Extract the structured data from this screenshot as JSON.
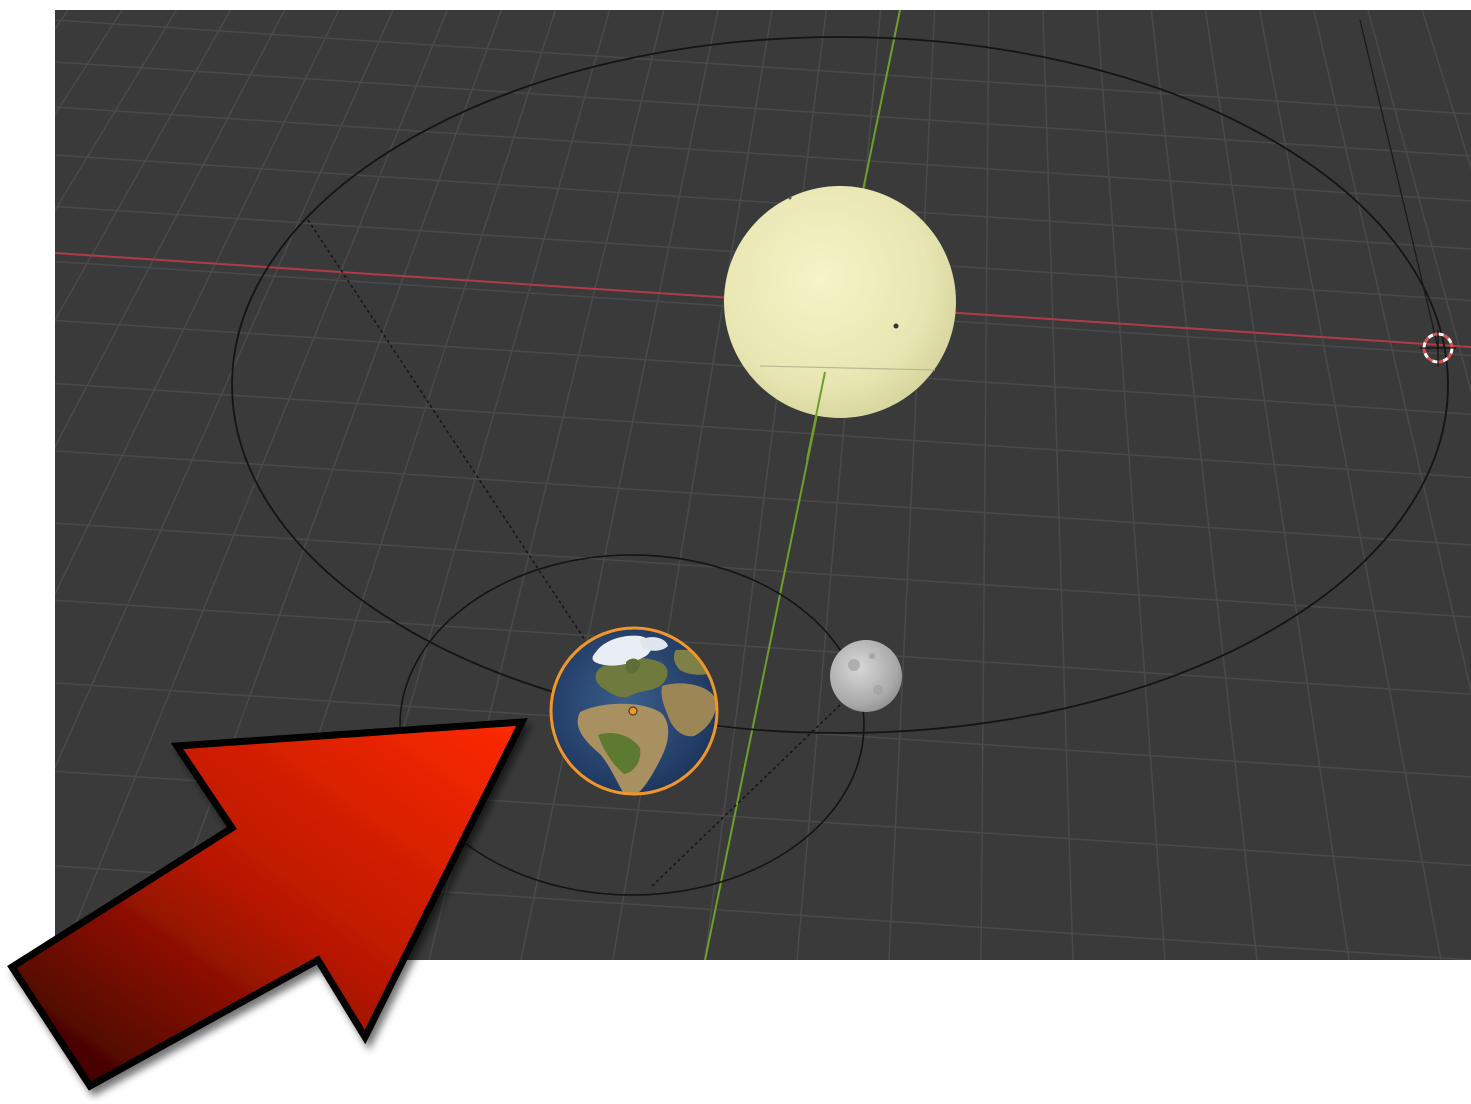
{
  "viewport": {
    "background_color": "#3a3a3a",
    "grid_color": "#4a4a4a",
    "x_axis_color": "#c0404f",
    "y_axis_color": "#6f9e2a",
    "orbit_line_color": "#141414",
    "page_background": "#ffffff"
  },
  "objects": {
    "sun": {
      "icon": "sun-sphere",
      "color": "#ecebb8"
    },
    "earth": {
      "icon": "earth-globe",
      "selected": true,
      "selection_color": "#f0962a"
    },
    "moon": {
      "icon": "moon-sphere",
      "color": "#b8b8b8"
    },
    "light": {
      "icon": "light-gizmo",
      "color": "#e05050"
    }
  },
  "annotation": {
    "icon": "arrow-pointer",
    "gradient_start": "#330000",
    "gradient_end": "#ff2a00",
    "outline_color": "#000000"
  }
}
